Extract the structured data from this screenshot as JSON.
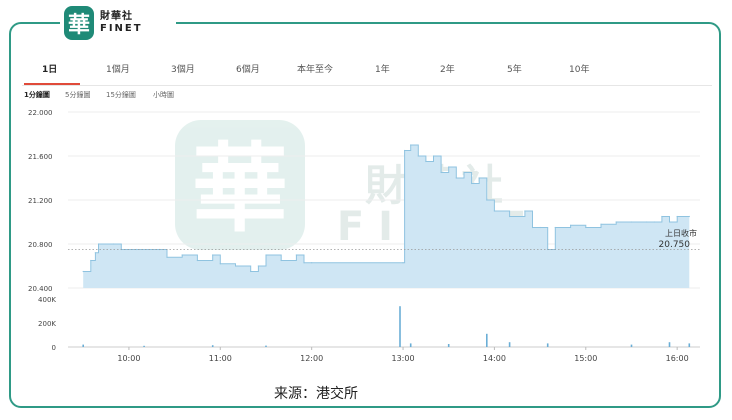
{
  "brand": {
    "mark": "華",
    "name_cn": "財華社",
    "name_en": "FINET"
  },
  "watermark": {
    "mark": "華",
    "cn": "財華社",
    "en": "FINET"
  },
  "tabs": [
    {
      "label": "1日",
      "active": true
    },
    {
      "label": "1個月",
      "active": false
    },
    {
      "label": "3個月",
      "active": false
    },
    {
      "label": "6個月",
      "active": false
    },
    {
      "label": "本年至今",
      "active": false
    },
    {
      "label": "1年",
      "active": false
    },
    {
      "label": "2年",
      "active": false
    },
    {
      "label": "5年",
      "active": false
    },
    {
      "label": "10年",
      "active": false
    }
  ],
  "subtabs": [
    {
      "label": "1分鐘圖",
      "active": true
    },
    {
      "label": "5分鐘圖",
      "active": false
    },
    {
      "label": "15分鐘圖",
      "active": false
    },
    {
      "label": "小時圖",
      "active": false
    }
  ],
  "source": "来源：港交所",
  "colors": {
    "frame": "#2f9a86",
    "area_fill": "#cfe6f4",
    "area_line": "#8fc3e0",
    "volume": "#6aaed6",
    "active_tab": "#e04a3a"
  },
  "chart_data": {
    "type": "area",
    "title": "",
    "price_axis": {
      "ylim": [
        20.4,
        22.0
      ],
      "ticks": [
        "20.400",
        "20.800",
        "21.200",
        "21.600",
        "22.000"
      ]
    },
    "volume_axis": {
      "ylim": [
        0,
        400000
      ],
      "ticks": [
        "0",
        "200K",
        "400K"
      ]
    },
    "x_ticks": [
      "10:00",
      "11:00",
      "12:00",
      "13:00",
      "14:00",
      "15:00",
      "16:00"
    ],
    "prev_close": {
      "label_text": "上日收市",
      "value_text": "20.750",
      "value": 20.75
    },
    "price_series": [
      {
        "t": "09:30",
        "p": 20.55
      },
      {
        "t": "09:35",
        "p": 20.65
      },
      {
        "t": "09:38",
        "p": 20.72
      },
      {
        "t": "09:40",
        "p": 20.8
      },
      {
        "t": "09:50",
        "p": 20.8
      },
      {
        "t": "09:55",
        "p": 20.75
      },
      {
        "t": "10:05",
        "p": 20.75
      },
      {
        "t": "10:20",
        "p": 20.75
      },
      {
        "t": "10:25",
        "p": 20.68
      },
      {
        "t": "10:35",
        "p": 20.7
      },
      {
        "t": "10:45",
        "p": 20.65
      },
      {
        "t": "10:55",
        "p": 20.7
      },
      {
        "t": "11:00",
        "p": 20.62
      },
      {
        "t": "11:10",
        "p": 20.6
      },
      {
        "t": "11:20",
        "p": 20.55
      },
      {
        "t": "11:25",
        "p": 20.6
      },
      {
        "t": "11:30",
        "p": 20.7
      },
      {
        "t": "11:40",
        "p": 20.65
      },
      {
        "t": "11:50",
        "p": 20.7
      },
      {
        "t": "11:55",
        "p": 20.63
      },
      {
        "t": "12:00",
        "p": 20.63
      },
      {
        "t": "13:00",
        "p": 20.63
      },
      {
        "t": "13:01",
        "p": 21.65
      },
      {
        "t": "13:05",
        "p": 21.7
      },
      {
        "t": "13:10",
        "p": 21.6
      },
      {
        "t": "13:15",
        "p": 21.55
      },
      {
        "t": "13:20",
        "p": 21.6
      },
      {
        "t": "13:25",
        "p": 21.45
      },
      {
        "t": "13:30",
        "p": 21.5
      },
      {
        "t": "13:35",
        "p": 21.4
      },
      {
        "t": "13:40",
        "p": 21.45
      },
      {
        "t": "13:45",
        "p": 21.35
      },
      {
        "t": "13:50",
        "p": 21.4
      },
      {
        "t": "13:55",
        "p": 21.2
      },
      {
        "t": "14:00",
        "p": 21.1
      },
      {
        "t": "14:10",
        "p": 21.05
      },
      {
        "t": "14:20",
        "p": 21.1
      },
      {
        "t": "14:25",
        "p": 20.95
      },
      {
        "t": "14:30",
        "p": 20.95
      },
      {
        "t": "14:35",
        "p": 20.75
      },
      {
        "t": "14:40",
        "p": 20.95
      },
      {
        "t": "14:50",
        "p": 20.97
      },
      {
        "t": "15:00",
        "p": 20.95
      },
      {
        "t": "15:10",
        "p": 20.98
      },
      {
        "t": "15:20",
        "p": 21.0
      },
      {
        "t": "15:30",
        "p": 21.0
      },
      {
        "t": "15:40",
        "p": 21.0
      },
      {
        "t": "15:45",
        "p": 21.0
      },
      {
        "t": "15:50",
        "p": 21.05
      },
      {
        "t": "15:55",
        "p": 21.0
      },
      {
        "t": "16:00",
        "p": 21.05
      },
      {
        "t": "16:08",
        "p": 21.05
      }
    ],
    "volume_series": [
      {
        "t": "09:30",
        "v": 20000
      },
      {
        "t": "10:10",
        "v": 10000
      },
      {
        "t": "10:55",
        "v": 15000
      },
      {
        "t": "11:30",
        "v": 12000
      },
      {
        "t": "12:58",
        "v": 340000
      },
      {
        "t": "13:05",
        "v": 30000
      },
      {
        "t": "13:30",
        "v": 25000
      },
      {
        "t": "13:55",
        "v": 110000
      },
      {
        "t": "14:10",
        "v": 40000
      },
      {
        "t": "14:35",
        "v": 30000
      },
      {
        "t": "15:30",
        "v": 20000
      },
      {
        "t": "15:55",
        "v": 40000
      },
      {
        "t": "16:08",
        "v": 30000
      }
    ]
  }
}
